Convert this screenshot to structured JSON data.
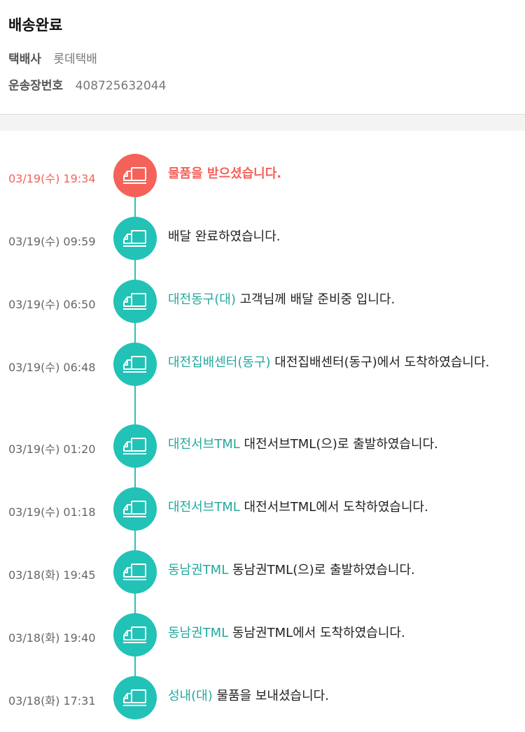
{
  "header": {
    "status": "배송완료",
    "carrier_label": "택배사",
    "carrier_value": "롯데택배",
    "tracking_label": "운송장번호",
    "tracking_value": "408725632044"
  },
  "colors": {
    "accent_teal": "#22c2b6",
    "location_teal": "#23a89e",
    "active_red": "#f4625a"
  },
  "events": [
    {
      "time": "03/19(수) 19:34",
      "location": "",
      "message": "물품을 받으셨습니다.",
      "icon": "delivery-truck-icon"
    },
    {
      "time": "03/19(수) 09:59",
      "location": "",
      "message": "배달 완료하였습니다.",
      "icon": "delivery-truck-icon"
    },
    {
      "time": "03/19(수) 06:50",
      "location": "대전동구(대)",
      "message": "고객님께 배달 준비중 입니다.",
      "icon": "delivery-truck-icon"
    },
    {
      "time": "03/19(수) 06:48",
      "location": "대전집배센터(동구)",
      "message": "대전집배센터(동구)에서 도착하였습니다.",
      "icon": "delivery-truck-icon"
    },
    {
      "time": "03/19(수) 01:20",
      "location": "대전서브TML",
      "message": "대전서브TML(으)로 출발하였습니다.",
      "icon": "delivery-truck-icon"
    },
    {
      "time": "03/19(수) 01:18",
      "location": "대전서브TML",
      "message": "대전서브TML에서 도착하였습니다.",
      "icon": "delivery-truck-icon"
    },
    {
      "time": "03/18(화) 19:45",
      "location": "동남권TML",
      "message": "동남권TML(으)로 출발하였습니다.",
      "icon": "delivery-truck-icon"
    },
    {
      "time": "03/18(화) 19:40",
      "location": "동남권TML",
      "message": "동남권TML에서 도착하였습니다.",
      "icon": "delivery-truck-icon"
    },
    {
      "time": "03/18(화) 17:31",
      "location": "성내(대)",
      "message": "물품을 보내셨습니다.",
      "icon": "delivery-truck-icon"
    }
  ]
}
